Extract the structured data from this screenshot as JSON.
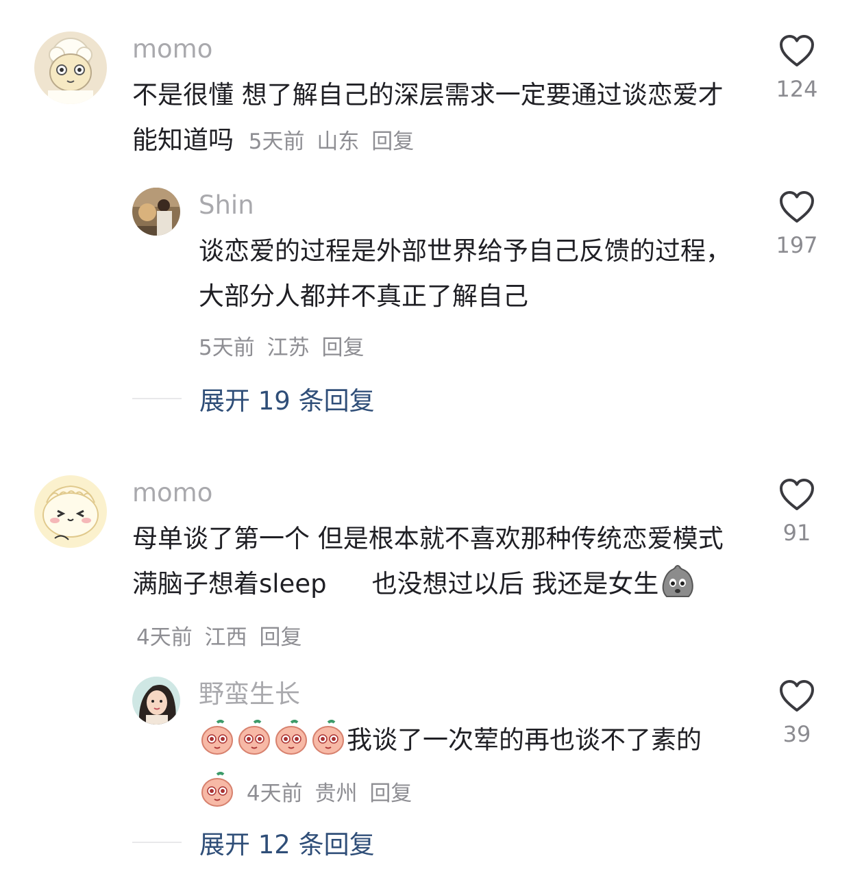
{
  "comments": [
    {
      "username": "momo",
      "avatar": "sheep-cartoon-avatar",
      "text": "不是很懂 想了解自己的深层需求一定要通过谈恋爱才能知道吗",
      "time": "5天前",
      "location": "山东",
      "reply_label": "回复",
      "likes": "124",
      "replies": [
        {
          "username": "Shin",
          "avatar": "photo-avatar",
          "text": "谈恋爱的过程是外部世界给予自己反馈的过程，大部分人都并不真正了解自己",
          "time": "5天前",
          "location": "江苏",
          "reply_label": "回复",
          "likes": "197"
        }
      ],
      "expand_label": "展开 19 条回复"
    },
    {
      "username": "momo",
      "avatar": "dumpling-cartoon-avatar",
      "text_part1": "母单谈了第一个 但是根本就不喜欢那种传统恋爱模式 满脑子想着sleep",
      "text_part2": "也没想过以后 我还是女生",
      "emoji": "stone-face-emoji",
      "time": "4天前",
      "location": "江西",
      "reply_label": "回复",
      "likes": "91",
      "replies": [
        {
          "username": "野蛮生长",
          "avatar": "girl-illustration-avatar",
          "text": "我谈了一次荤的再也谈不了素的",
          "emoji": "peach-face-emoji",
          "time": "4天前",
          "location": "贵州",
          "reply_label": "回复",
          "likes": "39"
        }
      ],
      "expand_label": "展开 12 条回复"
    }
  ],
  "colors": {
    "username": "#a9a9ad",
    "text": "#1f1f24",
    "meta": "#8e8e93",
    "expand": "#2f4e78",
    "heart": "#3a3a3f"
  },
  "icons": {
    "like": "heart-outline-icon"
  }
}
